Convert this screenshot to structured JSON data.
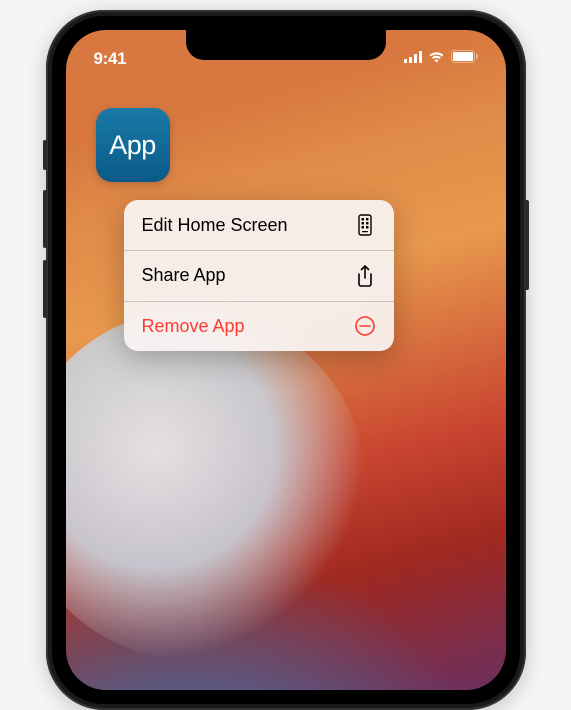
{
  "status": {
    "time": "9:41"
  },
  "app": {
    "label": "App"
  },
  "menu": {
    "items": [
      {
        "label": "Edit Home Screen",
        "icon": "home-screen-icon",
        "danger": false
      },
      {
        "label": "Share App",
        "icon": "share-icon",
        "danger": false
      },
      {
        "label": "Remove App",
        "icon": "remove-icon",
        "danger": true
      }
    ]
  }
}
